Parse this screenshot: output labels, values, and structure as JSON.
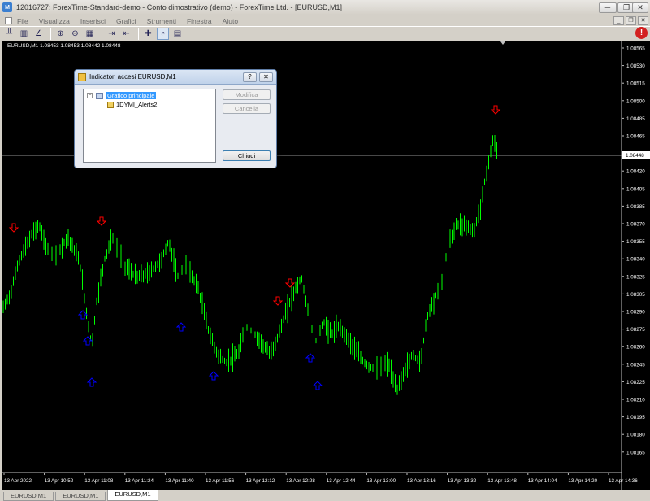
{
  "window": {
    "title": "12016727: ForexTime-Standard-demo - Conto dimostrativo (demo) - ForexTime Ltd. - [EURUSD,M1]",
    "min": "─",
    "max": "❐",
    "close": "✕"
  },
  "menu": {
    "items": [
      "File",
      "Visualizza",
      "Inserisci",
      "Grafici",
      "Strumenti",
      "Finestra",
      "Aiuto"
    ]
  },
  "chart": {
    "symbol_label": "EURUSD,M1  1.08453 1.08453 1.08442 1.08448",
    "current_price": "1.08448",
    "price_axis": [
      "1.08565",
      "1.08530",
      "1.08515",
      "1.08500",
      "1.08485",
      "1.08465",
      "1.08435",
      "1.08420",
      "1.08405",
      "1.08385",
      "1.08370",
      "1.08355",
      "1.08340",
      "1.08325",
      "1.08305",
      "1.08290",
      "1.08275",
      "1.08260",
      "1.08245",
      "1.08225",
      "1.08210",
      "1.08195",
      "1.08180",
      "1.08165"
    ],
    "time_axis": [
      "13 Apr 2022",
      "13 Apr 10:52",
      "13 Apr 11:08",
      "13 Apr 11:24",
      "13 Apr 11:40",
      "13 Apr 11:56",
      "13 Apr 12:12",
      "13 Apr 12:28",
      "13 Apr 12:44",
      "13 Apr 13:00",
      "13 Apr 13:16",
      "13 Apr 13:32",
      "13 Apr 13:48",
      "13 Apr 14:04",
      "13 Apr 14:20",
      "13 Apr 14:36"
    ],
    "colors": {
      "candle": "#00ff00",
      "background": "#000000",
      "buy_arrow": "#0000ff",
      "sell_arrow": "#ff0000",
      "price_line": "#c0c0c0"
    }
  },
  "dialog": {
    "title": "Indicatori accesi EURUSD,M1",
    "help": "?",
    "close": "✕",
    "tree": {
      "root": "Grafico principale",
      "child": "1DYMI_Alerts2"
    },
    "buttons": {
      "modify": "Modifica",
      "delete": "Cancella",
      "close": "Chiudi"
    }
  },
  "tabs": [
    "EURUSD,M1",
    "EURUSD,M1",
    "EURUSD,M1"
  ],
  "alert_badge": "!"
}
